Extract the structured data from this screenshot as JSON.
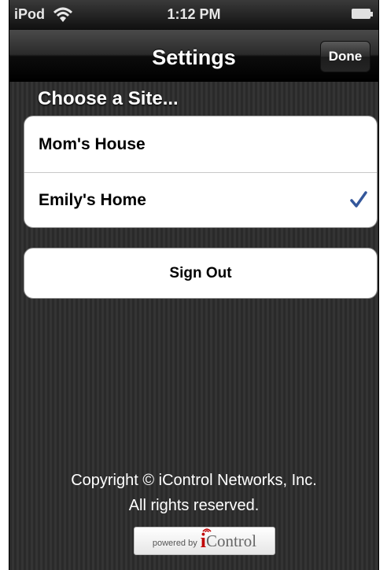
{
  "status_bar": {
    "carrier": "iPod",
    "time": "1:12 PM",
    "wifi_icon": "wifi-icon",
    "battery_icon": "battery-icon"
  },
  "nav_bar": {
    "title": "Settings",
    "done_label": "Done"
  },
  "site_section": {
    "header": "Choose a Site...",
    "items": [
      {
        "label": "Mom's House",
        "selected": false
      },
      {
        "label": "Emily's Home",
        "selected": true
      }
    ],
    "checkmark_icon": "checkmark-icon",
    "checkmark_color": "#34579b"
  },
  "sign_out": {
    "label": "Sign Out"
  },
  "footer": {
    "copyright_line1": "Copyright © iControl Networks, Inc.",
    "copyright_line2": "All rights reserved.",
    "powered_by": "powered by",
    "brand_i": "i",
    "brand_name": "Control"
  }
}
